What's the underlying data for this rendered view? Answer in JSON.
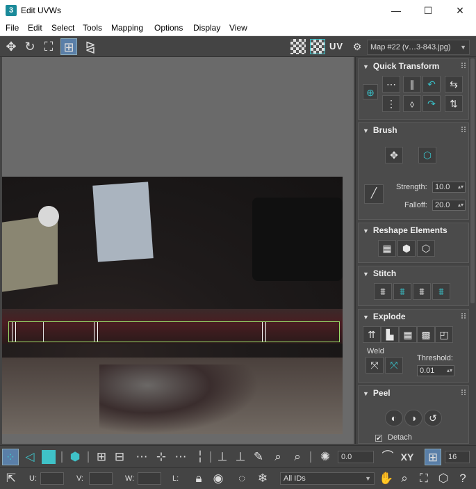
{
  "window": {
    "title": "Edit UVWs",
    "app_icon": "3",
    "minimize": "—",
    "maximize": "☐",
    "close": "✕"
  },
  "menu": [
    "File",
    "Edit",
    "Select",
    "Tools",
    "Mapping",
    "Options",
    "Display",
    "View"
  ],
  "toolbar_top": {
    "uv_label": "UV",
    "map_select": "Map #22 (v…3-843.jpg)"
  },
  "quick_transform": {
    "title": "Quick Transform"
  },
  "brush": {
    "title": "Brush",
    "strength_label": "Strength:",
    "strength_value": "10.0",
    "falloff_label": "Falloff:",
    "falloff_value": "20.0"
  },
  "reshape": {
    "title": "Reshape Elements"
  },
  "stitch": {
    "title": "Stitch"
  },
  "explode": {
    "title": "Explode",
    "weld_label": "Weld",
    "threshold_label": "Threshold:",
    "threshold_value": "0.01"
  },
  "peel": {
    "title": "Peel",
    "detach_label": "Detach",
    "detach_checked": "✔"
  },
  "bottom1": {
    "angle_value": "0.0",
    "xy_label": "XY",
    "grid_value": "16"
  },
  "bottom2": {
    "u_label": "U:",
    "v_label": "V:",
    "w_label": "W:",
    "l_label": "L:",
    "ids_select": "All IDs"
  },
  "colors": {
    "accent": "#39c0c8",
    "seam_box": "#9be06a",
    "active_tool": "#5a7fa8"
  }
}
